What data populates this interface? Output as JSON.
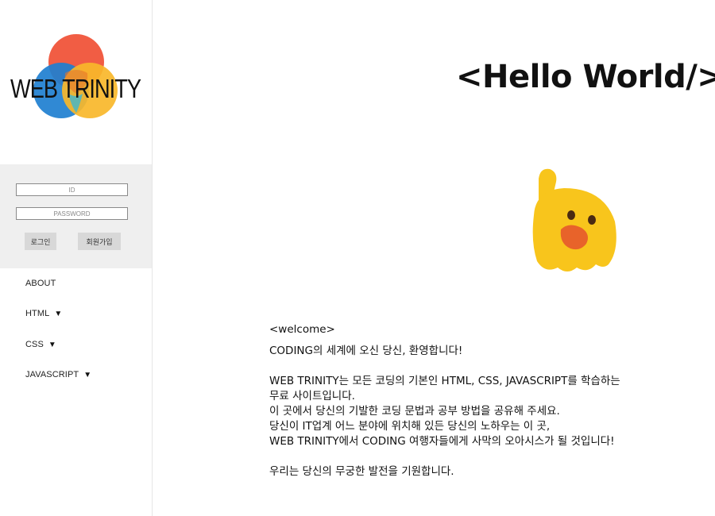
{
  "logo": {
    "text": "WEB TRINITY",
    "colors": [
      "#f0543a",
      "#1e88d6",
      "#f9b72a"
    ]
  },
  "login": {
    "id_placeholder": "ID",
    "password_placeholder": "PASSWORD",
    "login_label": "로그인",
    "join_label": "회원가입"
  },
  "nav": {
    "items": [
      {
        "label": "ABOUT",
        "arrow": ""
      },
      {
        "label": "HTML",
        "arrow": "▼"
      },
      {
        "label": "CSS",
        "arrow": "▼"
      },
      {
        "label": "JAVASCRIPT",
        "arrow": "▼"
      }
    ]
  },
  "main": {
    "heading": "<Hello World/>",
    "emoji": "raised-hand-ghost-icon",
    "welcome_tag": "<welcome>",
    "line1": "CODING의 세계에 오신 당신, 환영합니다!",
    "line2": "WEB TRINITY는 모든 코딩의 기본인 HTML, CSS, JAVASCRIPT를 학습하는",
    "line3": "무료 사이트입니다.",
    "line4": "이 곳에서 당신의 기발한 코딩 문법과 공부 방법을 공유해 주세요.",
    "line5": "당신이 IT업계 어느 분야에 위치해 있든 당신의 노하우는 이 곳,",
    "line6": "WEB TRINITY에서 CODING 여행자들에게 사막의 오아시스가 될 것입니다!",
    "line7": "우리는 당신의 무궁한 발전을 기원합니다."
  }
}
